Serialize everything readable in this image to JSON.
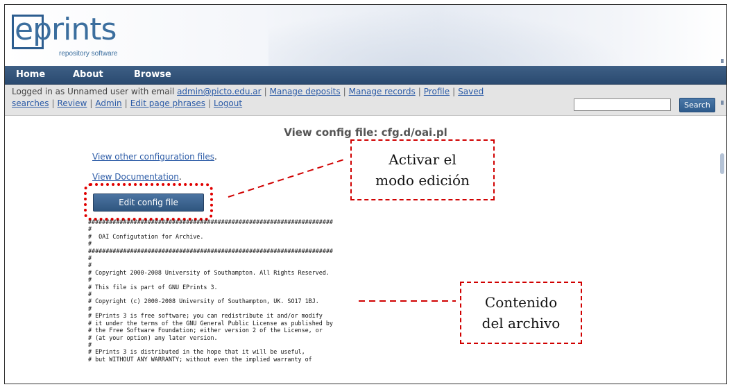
{
  "header": {
    "logo_text": "eprints",
    "logo_subtitle": "repository software"
  },
  "nav": {
    "items": [
      "Home",
      "About",
      "Browse"
    ]
  },
  "userbar": {
    "line1_prefix": "Logged in as Unnamed user with email",
    "email_link": "admin@picto.edu.ar",
    "links_line1": [
      "Manage deposits",
      "Manage records",
      "Profile",
      "Saved"
    ],
    "links_line2": [
      "searches",
      "Review",
      "Admin",
      "Edit page phrases",
      "Logout"
    ],
    "search_placeholder": "",
    "search_button": "Search"
  },
  "main": {
    "title": "View config file: cfg.d/oai.pl",
    "link_other": "View other configuration files",
    "link_other_suffix": ".",
    "link_docs": "View Documentation",
    "link_docs_suffix": ".",
    "edit_button": "Edit config file",
    "file_lines": [
      "######################################################################",
      "#",
      "#  OAI Configutation for Archive.",
      "#",
      "######################################################################",
      "#",
      "#",
      "# Copyright 2000-2008 University of Southampton. All Rights Reserved.",
      "#",
      "# This file is part of GNU EPrints 3.",
      "#",
      "# Copyright (c) 2000-2008 University of Southampton, UK. SO17 1BJ.",
      "#",
      "# EPrints 3 is free software; you can redistribute it and/or modify",
      "# it under the terms of the GNU General Public License as published by",
      "# the Free Software Foundation; either version 2 of the License, or",
      "# (at your option) any later version.",
      "#",
      "# EPrints 3 is distributed in the hope that it will be useful,",
      "# but WITHOUT ANY WARRANTY; without even the implied warranty of"
    ]
  },
  "annotations": {
    "edit_mode": [
      "Activar el",
      "modo edición"
    ],
    "file_content": [
      "Contenido",
      "del archivo"
    ],
    "color": "#d00000"
  }
}
